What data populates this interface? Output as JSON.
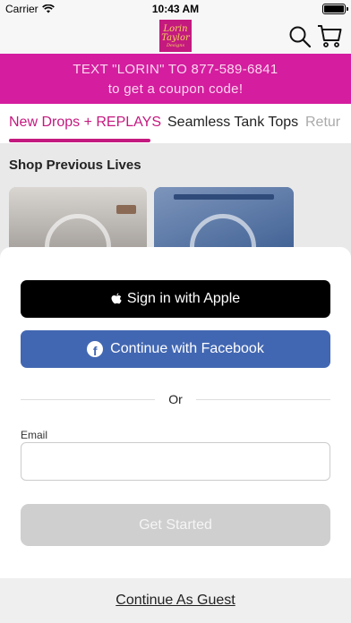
{
  "status_bar": {
    "carrier": "Carrier",
    "time": "10:43 AM"
  },
  "header": {
    "logo_line1": "Lorin",
    "logo_line2": "Taylor",
    "logo_line3": "Designs",
    "icons": [
      "search-icon",
      "cart-icon"
    ]
  },
  "promo": {
    "line1": "TEXT \"LORIN\" TO 877-589-6841",
    "line2": "to get a coupon code!",
    "bg_color": "#d41d9f"
  },
  "tabs": [
    {
      "label": "New Drops + REPLAYS",
      "active": true
    },
    {
      "label": "Seamless Tank Tops",
      "active": false
    },
    {
      "label": "Retur",
      "active": false
    }
  ],
  "section": {
    "title": "Shop Previous Lives"
  },
  "sheet": {
    "apple_label": "Sign in with Apple",
    "facebook_label": "Continue with Facebook",
    "or_text": "Or",
    "email_label": "Email",
    "email_value": "",
    "email_placeholder": "",
    "get_started_label": "Get Started",
    "guest_label": "Continue As Guest"
  },
  "colors": {
    "accent": "#c4197f",
    "facebook": "#4267b2",
    "disabled": "#cfcfcf"
  }
}
